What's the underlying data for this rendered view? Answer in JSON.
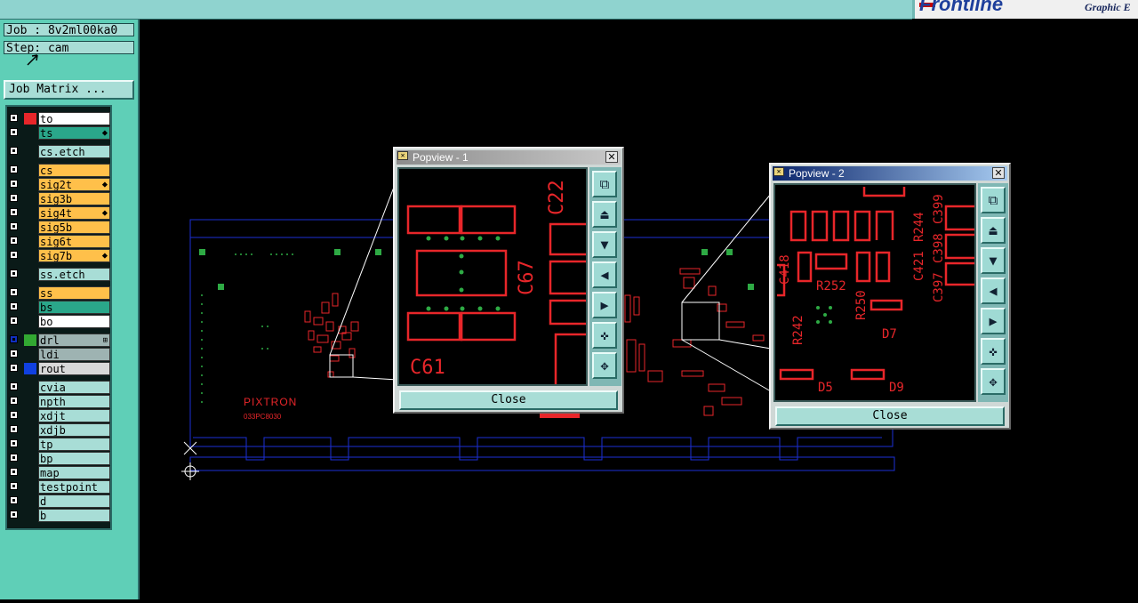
{
  "app": {
    "brand": "Frontline",
    "subtitle": "Graphic E"
  },
  "job": {
    "job_line": "Job : 8v2ml00ka0",
    "step_line": "Step: cam",
    "matrix_button": "Job Matrix ..."
  },
  "layers": [
    {
      "name": "to",
      "swatch": "#e8262a",
      "bg": "#ffffff",
      "mark": ""
    },
    {
      "name": "ts",
      "swatch": "",
      "bg": "#2aa78a",
      "mark": "⬥"
    },
    {
      "name": "cs.etch",
      "swatch": "",
      "bg": "#a8ddd6",
      "mark": ""
    },
    {
      "name": "cs",
      "swatch": "",
      "bg": "#ffc04a",
      "mark": ""
    },
    {
      "name": "sig2t",
      "swatch": "",
      "bg": "#ffc04a",
      "mark": "⬥"
    },
    {
      "name": "sig3b",
      "swatch": "",
      "bg": "#ffc04a",
      "mark": ""
    },
    {
      "name": "sig4t",
      "swatch": "",
      "bg": "#ffc04a",
      "mark": "⬥"
    },
    {
      "name": "sig5b",
      "swatch": "",
      "bg": "#ffc04a",
      "mark": ""
    },
    {
      "name": "sig6t",
      "swatch": "",
      "bg": "#ffc04a",
      "mark": ""
    },
    {
      "name": "sig7b",
      "swatch": "",
      "bg": "#ffc04a",
      "mark": "⬥"
    },
    {
      "name": "ss.etch",
      "swatch": "",
      "bg": "#a8ddd6",
      "mark": ""
    },
    {
      "name": "ss",
      "swatch": "",
      "bg": "#ffc04a",
      "mark": ""
    },
    {
      "name": "bs",
      "swatch": "",
      "bg": "#2aa78a",
      "mark": ""
    },
    {
      "name": "bo",
      "swatch": "",
      "bg": "#ffffff",
      "mark": ""
    },
    {
      "name": "drl",
      "swatch": "#32a832",
      "bg": "#9eb3b2",
      "mark": "⊞",
      "selected": true
    },
    {
      "name": "ldi",
      "swatch": "",
      "bg": "#9eb3b2",
      "mark": ""
    },
    {
      "name": "rout",
      "swatch": "#1040e0",
      "bg": "#d8d8d8",
      "mark": ""
    },
    {
      "name": "cvia",
      "swatch": "",
      "bg": "#a8ddd6",
      "mark": ""
    },
    {
      "name": "npth",
      "swatch": "",
      "bg": "#a8ddd6",
      "mark": ""
    },
    {
      "name": "xdjt",
      "swatch": "",
      "bg": "#a8ddd6",
      "mark": ""
    },
    {
      "name": "xdjb",
      "swatch": "",
      "bg": "#a8ddd6",
      "mark": ""
    },
    {
      "name": "tp",
      "swatch": "",
      "bg": "#a8ddd6",
      "mark": ""
    },
    {
      "name": "bp",
      "swatch": "",
      "bg": "#a8ddd6",
      "mark": ""
    },
    {
      "name": "map",
      "swatch": "",
      "bg": "#a8ddd6",
      "mark": ""
    },
    {
      "name": "testpoint",
      "swatch": "",
      "bg": "#a8ddd6",
      "mark": ""
    },
    {
      "name": "d",
      "swatch": "",
      "bg": "#a8ddd6",
      "mark": ""
    },
    {
      "name": "b",
      "swatch": "",
      "bg": "#a8ddd6",
      "mark": ""
    }
  ],
  "board": {
    "logo": "PIXTRON",
    "part_no": "033PC8030"
  },
  "popview1": {
    "title": "Popview - 1",
    "close_label": "Close",
    "refdes": [
      "C22",
      "C67",
      "C61"
    ],
    "tools": [
      "fit-icon",
      "pan-up-icon",
      "pan-down-icon",
      "pan-left-icon",
      "pan-right-icon",
      "zoom-in-icon",
      "zoom-out-icon"
    ]
  },
  "popview2": {
    "title": "Popview - 2",
    "close_label": "Close",
    "refdes": [
      "C421",
      "R244",
      "C397",
      "C398",
      "C399",
      "C418",
      "R252",
      "R250",
      "R242",
      "D7",
      "D5",
      "D9"
    ],
    "tools": [
      "fit-icon",
      "pan-up-icon",
      "pan-down-icon",
      "pan-left-icon",
      "pan-right-icon",
      "zoom-in-icon",
      "zoom-out-icon"
    ]
  },
  "colors": {
    "panel": "#5fcfb7",
    "titlebar": "#8fd3cf",
    "copper": "#e8262a",
    "outline": "#1b2fd6",
    "pad": "#2eaa44"
  }
}
